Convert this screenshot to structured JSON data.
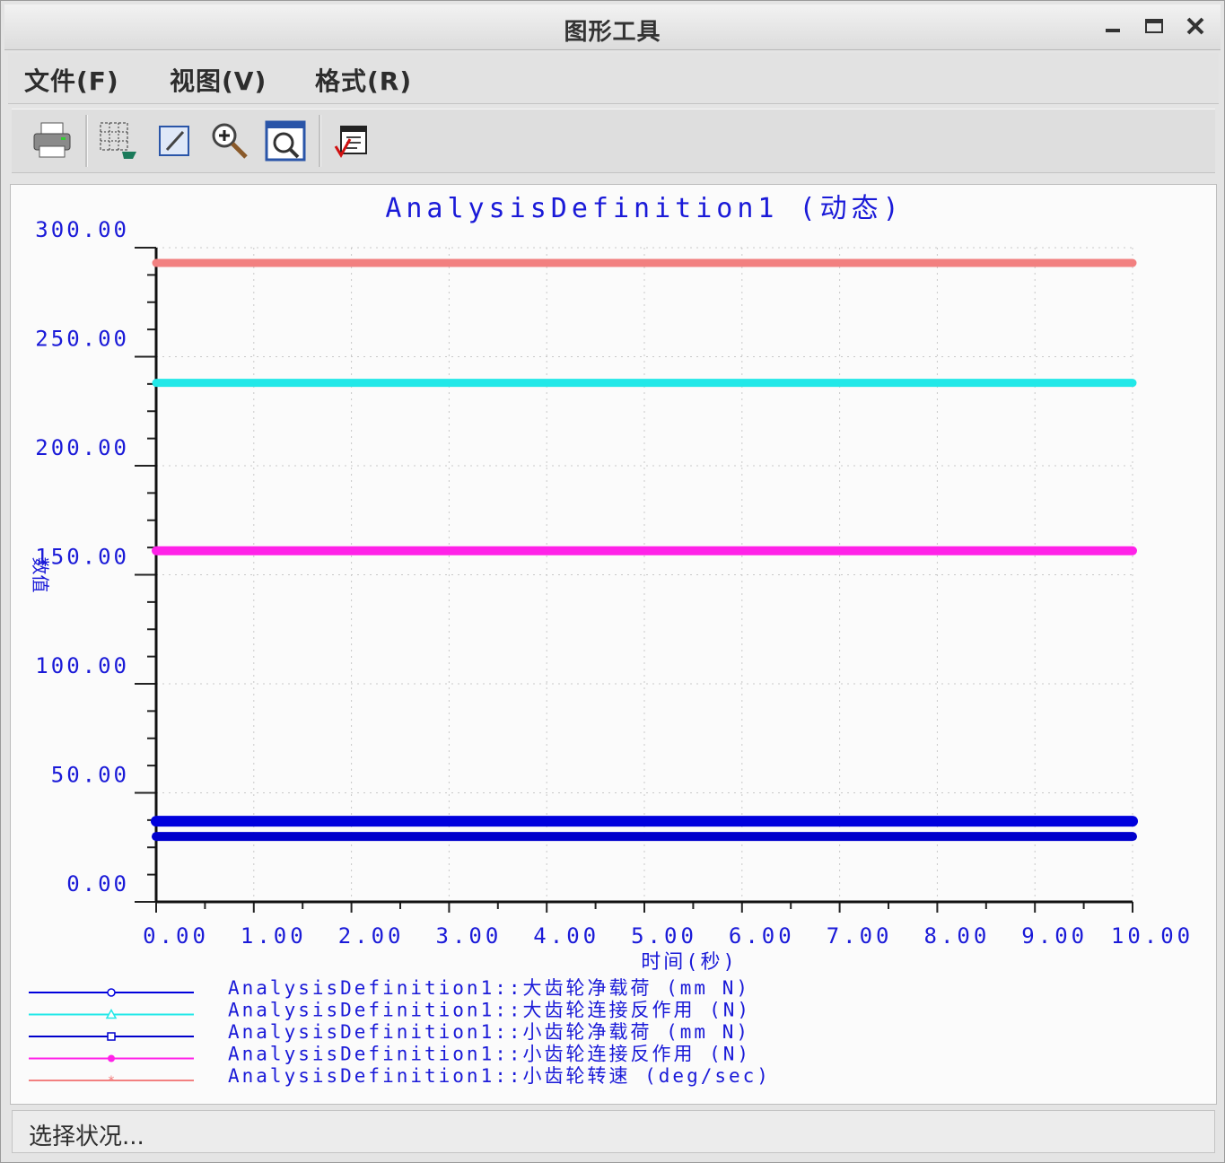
{
  "window": {
    "title": "图形工具",
    "min": "–",
    "max": "□",
    "close": "✕"
  },
  "menu": {
    "file": "文件(F)",
    "view": "视图(V)",
    "format": "格式(R)"
  },
  "toolbar": {
    "icons": [
      "printer-icon",
      "grid-select-icon",
      "edit-icon",
      "zoom-in-icon",
      "zoom-fit-icon",
      "export-icon"
    ]
  },
  "status": {
    "text": "选择状况..."
  },
  "chart_data": {
    "type": "line",
    "title": "AnalysisDefinition1 (动态)",
    "xlabel": "时间(秒)",
    "ylabel": "数值",
    "xlim": [
      0,
      10
    ],
    "ylim": [
      0,
      300
    ],
    "xticks": [
      "0.00",
      "1.00",
      "2.00",
      "3.00",
      "4.00",
      "5.00",
      "6.00",
      "7.00",
      "8.00",
      "9.00",
      "10.00"
    ],
    "yticks": [
      "0.00",
      "50.00",
      "100.00",
      "150.00",
      "200.00",
      "250.00",
      "300.00"
    ],
    "grid": true,
    "legend_position": "bottom-left",
    "series": [
      {
        "name": "AnalysisDefinition1::大齿轮净载荷 (mm N)",
        "color": "#0000dd",
        "marker": "circle",
        "x": [
          0,
          10
        ],
        "y": [
          37,
          37
        ]
      },
      {
        "name": "AnalysisDefinition1::大齿轮连接反作用 (N)",
        "color": "#22e8e8",
        "marker": "triangle",
        "x": [
          0,
          10
        ],
        "y": [
          238,
          238
        ]
      },
      {
        "name": "AnalysisDefinition1::小齿轮净载荷 (mm N)",
        "color": "#0000cc",
        "marker": "square",
        "x": [
          0,
          10
        ],
        "y": [
          30,
          30
        ]
      },
      {
        "name": "AnalysisDefinition1::小齿轮连接反作用 (N)",
        "color": "#ff22e8",
        "marker": "filled-circle",
        "x": [
          0,
          10
        ],
        "y": [
          161,
          161
        ]
      },
      {
        "name": "AnalysisDefinition1::小齿轮转速 (deg/sec)",
        "color": "#f28080",
        "marker": "star",
        "x": [
          0,
          10
        ],
        "y": [
          293,
          293
        ]
      }
    ]
  }
}
